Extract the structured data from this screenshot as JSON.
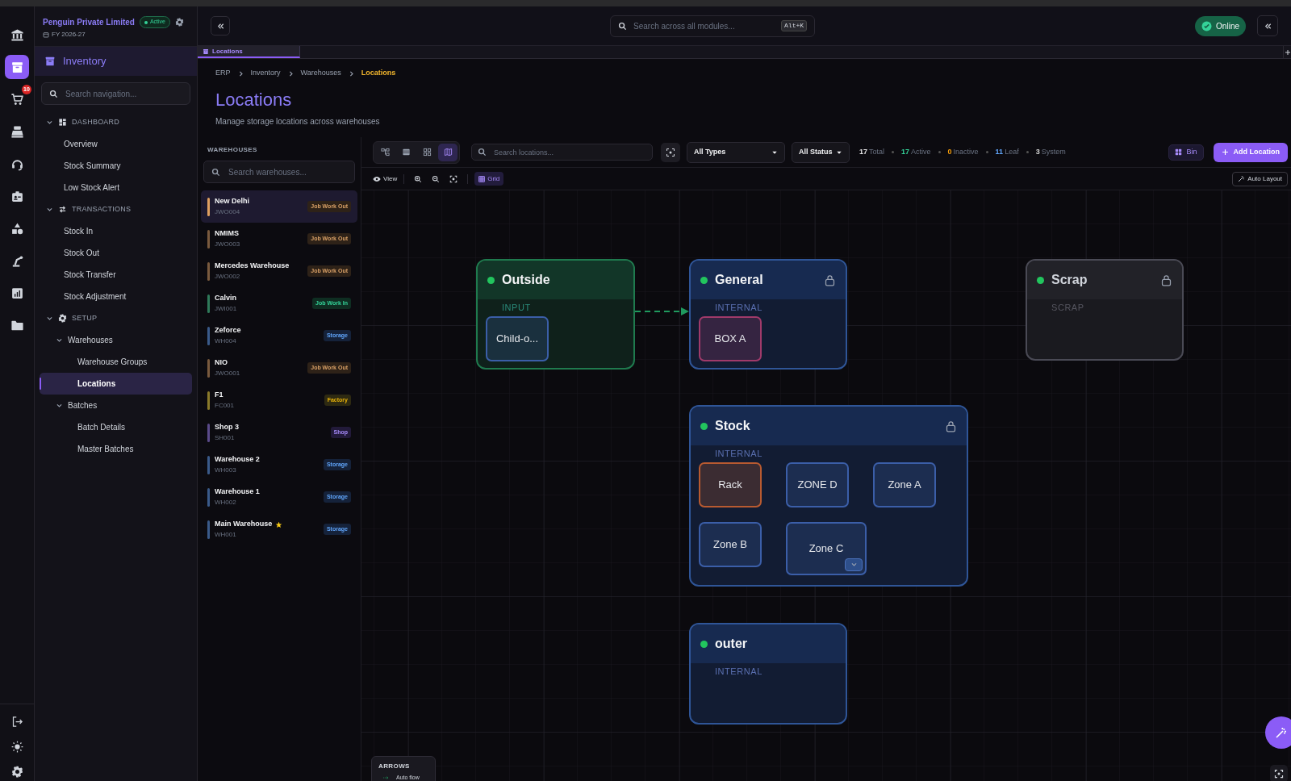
{
  "top_bar": {
    "search_placeholder": "Search across all modules...",
    "shortcut": "Alt+K",
    "status": "Online"
  },
  "rail": {
    "items": [
      {
        "kind": "bank",
        "selected": false
      },
      {
        "kind": "archive",
        "selected": true
      },
      {
        "kind": "cart",
        "selected": false,
        "badge": "10"
      },
      {
        "kind": "register",
        "selected": false
      },
      {
        "kind": "headset",
        "selected": false
      },
      {
        "kind": "id-card",
        "selected": false
      },
      {
        "kind": "shapes",
        "selected": false
      },
      {
        "kind": "robot-arm",
        "selected": false
      },
      {
        "kind": "chart",
        "selected": false
      },
      {
        "kind": "folder",
        "selected": false
      }
    ],
    "bottom": [
      {
        "kind": "logout"
      },
      {
        "kind": "sun"
      },
      {
        "kind": "gear"
      }
    ]
  },
  "sidebar": {
    "company": "Penguin Private Limited",
    "company_status": "Active",
    "fiscal_year": "FY 2026-27",
    "module": "Inventory",
    "search_placeholder": "Search navigation...",
    "sections": [
      {
        "label": "DASHBOARD",
        "kind": "dashboard",
        "expanded": true,
        "children": [
          {
            "label": "Overview",
            "selected": false
          },
          {
            "label": "Stock Summary",
            "selected": false
          },
          {
            "label": "Low Stock Alert",
            "selected": false
          }
        ]
      },
      {
        "label": "TRANSACTIONS",
        "kind": "transfer",
        "expanded": true,
        "children": [
          {
            "label": "Stock In",
            "selected": false
          },
          {
            "label": "Stock Out",
            "selected": false
          },
          {
            "label": "Stock Transfer",
            "selected": false
          },
          {
            "label": "Stock Adjustment",
            "selected": false
          }
        ]
      },
      {
        "label": "SETUP",
        "kind": "gear",
        "expanded": true,
        "children": [
          {
            "label": "Warehouses",
            "selected": false,
            "expanded": true,
            "children": [
              {
                "label": "Warehouse Groups",
                "selected": false
              },
              {
                "label": "Locations",
                "selected": true
              }
            ]
          },
          {
            "label": "Batches",
            "selected": false,
            "expanded": true,
            "children": [
              {
                "label": "Batch Details",
                "selected": false
              },
              {
                "label": "Master Batches",
                "selected": false
              }
            ]
          }
        ]
      }
    ]
  },
  "tabs": [
    {
      "label": "Locations",
      "selected": true
    }
  ],
  "breadcrumb": [
    "ERP",
    "Inventory",
    "Warehouses",
    "Locations"
  ],
  "page": {
    "title": "Locations",
    "subtitle": "Manage storage locations across warehouses"
  },
  "warehouses": {
    "heading": "WAREHOUSES",
    "search_placeholder": "Search warehouses...",
    "items": [
      {
        "name": "New Delhi",
        "code": "JWO004",
        "badge": "Job Work Out",
        "kind": "job-work-out",
        "color": "#e0a060",
        "selected": true,
        "starred": false
      },
      {
        "name": "NMIMS",
        "code": "JWO003",
        "badge": "Job Work Out",
        "kind": "job-work-out",
        "color": "#7a5a3e",
        "selected": false,
        "starred": false
      },
      {
        "name": "Mercedes Warehouse",
        "code": "JWO002",
        "badge": "Job Work Out",
        "kind": "job-work-out",
        "color": "#7a5a3e",
        "selected": false,
        "starred": false
      },
      {
        "name": "Calvin",
        "code": "JWI001",
        "badge": "Job Work In",
        "kind": "job-work-in",
        "color": "#2f7a5a",
        "selected": false,
        "starred": false
      },
      {
        "name": "Zeforce",
        "code": "WH004",
        "badge": "Storage",
        "kind": "storage",
        "color": "#3a5a8a",
        "selected": false,
        "starred": false
      },
      {
        "name": "NIO",
        "code": "JWO001",
        "badge": "Job Work Out",
        "kind": "job-work-out",
        "color": "#7a5a3e",
        "selected": false,
        "starred": false
      },
      {
        "name": "F1",
        "code": "FC001",
        "badge": "Factory",
        "kind": "factory",
        "color": "#8a7a2a",
        "selected": false,
        "starred": false
      },
      {
        "name": "Shop 3",
        "code": "SH001",
        "badge": "Shop",
        "kind": "shop",
        "color": "#5a4a8a",
        "selected": false,
        "starred": false
      },
      {
        "name": "Warehouse 2",
        "code": "WH003",
        "badge": "Storage",
        "kind": "storage",
        "color": "#3a5a8a",
        "selected": false,
        "starred": false
      },
      {
        "name": "Warehouse 1",
        "code": "WH002",
        "badge": "Storage",
        "kind": "storage",
        "color": "#3a5a8a",
        "selected": false,
        "starred": false
      },
      {
        "name": "Main Warehouse",
        "code": "WH001",
        "badge": "Storage",
        "kind": "storage",
        "color": "#3a5a8a",
        "selected": false,
        "starred": true
      }
    ]
  },
  "toolbar": {
    "views": [
      {
        "kind": "tree",
        "selected": false
      },
      {
        "kind": "list",
        "selected": false
      },
      {
        "kind": "grid",
        "selected": false
      },
      {
        "kind": "map",
        "selected": true
      }
    ],
    "search_placeholder": "Search locations...",
    "type_filter": "All Types",
    "status_filter": "All Status",
    "stats": [
      {
        "value": "17",
        "label": "Total",
        "color": "#e5e5e5"
      },
      {
        "value": "17",
        "label": "Active",
        "color": "#34d399"
      },
      {
        "value": "0",
        "label": "Inactive",
        "color": "#f59e0b"
      },
      {
        "value": "11",
        "label": "Leaf",
        "color": "#60a5fa"
      },
      {
        "value": "3",
        "label": "System",
        "color": "#d4d4d4"
      }
    ],
    "bin": "Bin",
    "add": "Add Location"
  },
  "canvas_toolbar": {
    "view": "View",
    "grid": {
      "label": "Grid",
      "on": true
    },
    "auto_layout": "Auto Layout"
  },
  "nodes": [
    {
      "name": "Outside",
      "type": "INPUT",
      "kind": "input",
      "locked": false,
      "arrow_out": true,
      "children": [
        {
          "label": "Child-o...",
          "color": "#3b5ea8",
          "expandable": false
        }
      ]
    },
    {
      "name": "General",
      "type": "INTERNAL",
      "kind": "internal",
      "locked": true,
      "arrow_out": false,
      "children": [
        {
          "label": "BOX A",
          "color": "#a03a6a",
          "expandable": false
        }
      ]
    },
    {
      "name": "Scrap",
      "type": "SCRAP",
      "kind": "scrap",
      "locked": true,
      "arrow_out": false
    },
    {
      "name": "Stock",
      "type": "INTERNAL",
      "kind": "internal",
      "locked": true,
      "arrow_out": false,
      "children": [
        {
          "label": "Rack",
          "color": "#b85a30",
          "expandable": false
        },
        {
          "label": "ZONE D",
          "color": "#3b5ea8",
          "expandable": false
        },
        {
          "label": "Zone A",
          "color": "#3b5ea8",
          "expandable": false
        },
        {
          "label": "Zone B",
          "color": "#3b5ea8",
          "expandable": false
        },
        {
          "label": "Zone C",
          "color": "#3b5ea8",
          "expandable": true
        }
      ]
    },
    {
      "name": "outer",
      "type": "INTERNAL",
      "kind": "internal",
      "locked": false,
      "arrow_out": false
    }
  ],
  "legend": {
    "title": "ARROWS",
    "items": [
      {
        "label": "Auto flow"
      }
    ]
  }
}
